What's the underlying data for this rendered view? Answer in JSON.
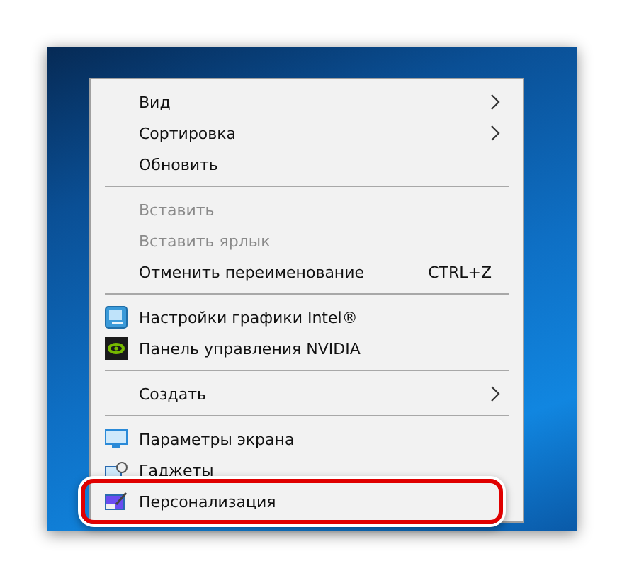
{
  "context_menu": {
    "items": [
      {
        "kind": "item",
        "label": "Вид",
        "submenu": true,
        "disabled": false,
        "highlighted": false
      },
      {
        "kind": "item",
        "label": "Сортировка",
        "submenu": true,
        "disabled": false,
        "highlighted": false
      },
      {
        "kind": "item",
        "label": "Обновить",
        "submenu": false,
        "disabled": false,
        "highlighted": false
      },
      {
        "kind": "separator"
      },
      {
        "kind": "item",
        "label": "Вставить",
        "submenu": false,
        "disabled": true,
        "highlighted": false
      },
      {
        "kind": "item",
        "label": "Вставить ярлык",
        "submenu": false,
        "disabled": true,
        "highlighted": false
      },
      {
        "kind": "item",
        "label": "Отменить переименование",
        "shortcut": "CTRL+Z",
        "submenu": false,
        "disabled": false,
        "highlighted": false
      },
      {
        "kind": "separator"
      },
      {
        "kind": "item",
        "label": "Настройки графики Intel®",
        "submenu": false,
        "disabled": false,
        "highlighted": false
      },
      {
        "kind": "item",
        "label": "Панель управления NVIDIA",
        "submenu": false,
        "disabled": false,
        "highlighted": false
      },
      {
        "kind": "separator"
      },
      {
        "kind": "item",
        "label": "Создать",
        "submenu": true,
        "disabled": false,
        "highlighted": false
      },
      {
        "kind": "separator"
      },
      {
        "kind": "item",
        "label": "Параметры экрана",
        "submenu": false,
        "disabled": false,
        "highlighted": false
      },
      {
        "kind": "item",
        "label": "Гаджеты",
        "submenu": false,
        "disabled": false,
        "highlighted": false
      },
      {
        "kind": "item",
        "label": "Персонализация",
        "submenu": false,
        "disabled": false,
        "highlighted": true
      }
    ]
  }
}
